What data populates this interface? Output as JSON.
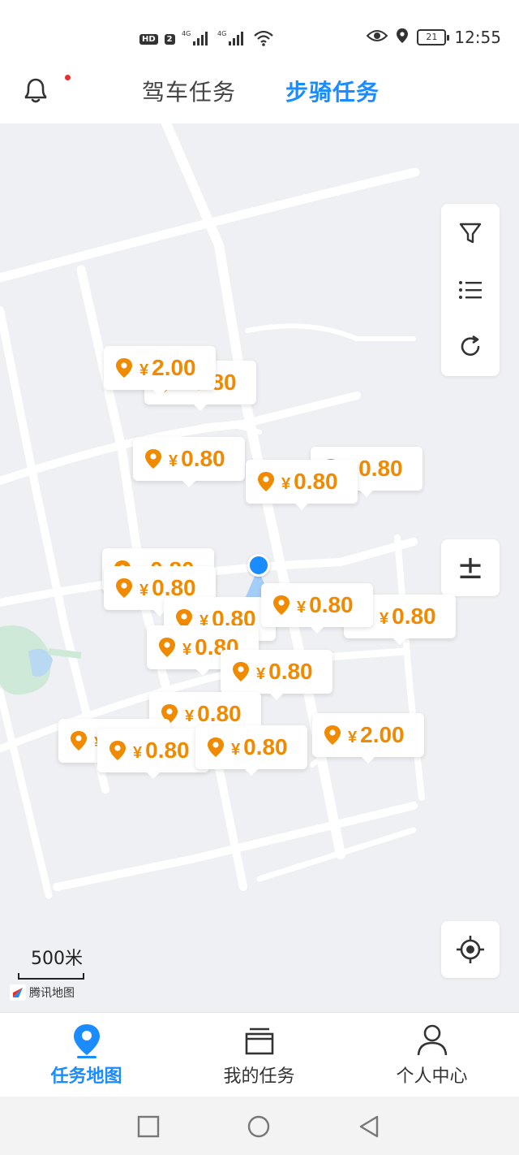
{
  "status_bar": {
    "hd_label": "HD",
    "sim_label": "2",
    "signal1_label": "4G",
    "signal2_label": "4G",
    "battery": "21",
    "time": "12:55"
  },
  "header": {
    "tabs": [
      {
        "label": "驾车任务",
        "active": false
      },
      {
        "label": "步骑任务",
        "active": true
      }
    ]
  },
  "map": {
    "markers": [
      {
        "price": "0.80"
      },
      {
        "price": "2.00"
      },
      {
        "price": "0.80"
      },
      {
        "price": "0.80"
      },
      {
        "price": "0.80"
      },
      {
        "price": "0.80"
      },
      {
        "price": "0.80"
      },
      {
        "price": "0.80"
      },
      {
        "price": "0.80"
      },
      {
        "price": "0.80"
      },
      {
        "price": "0.80"
      },
      {
        "price": "0.80"
      },
      {
        "price": "0.80"
      },
      {
        "price": "0.80"
      },
      {
        "price": "0.80"
      },
      {
        "price": "0.80"
      },
      {
        "price": "2.00"
      }
    ],
    "currency_symbol": "¥",
    "scale_label": "500米",
    "provider_label": "腾讯地图",
    "zoom_label": "±"
  },
  "bottom_nav": {
    "items": [
      {
        "label": "任务地图",
        "active": true
      },
      {
        "label": "我的任务",
        "active": false
      },
      {
        "label": "个人中心",
        "active": false
      }
    ]
  },
  "colors": {
    "accent": "#1a8cff",
    "price": "#f08a00",
    "map_bg": "#eef0f3"
  }
}
